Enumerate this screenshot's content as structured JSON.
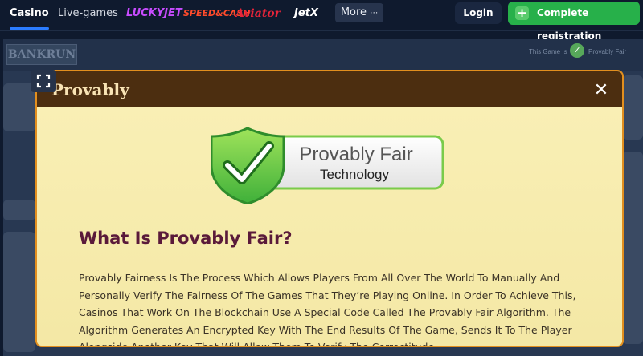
{
  "nav": {
    "tabs": [
      {
        "label": "Casino",
        "active": true
      },
      {
        "label": "Live-games",
        "active": false
      }
    ],
    "game_logos": [
      "LUCKYJET",
      "SPEED&CASH",
      "Aviator",
      "JetX"
    ],
    "more_label": "More",
    "more_icon": "ellipsis-icon",
    "login_label": "Login",
    "register_label": "Complete registration",
    "register_icon": "plus-icon"
  },
  "game": {
    "logo_text": "BANKRUN",
    "status_label": "This Game Is",
    "status_value": "Provably Fair"
  },
  "modal": {
    "title": "Provably",
    "badge": {
      "line1": "Provably Fair",
      "line2": "Technology"
    },
    "heading": "What Is Provably Fair?",
    "paragraph": "Provably Fairness Is The Process Which Allows Players From All Over The World To Manually And Personally Verify The Fairness Of The Games That They’re Playing Online. In Order To Achieve This, Casinos That Work On The Blockchain Use A Special Code Called The Provably Fair Algorithm. The Algorithm Generates An Encrypted Key With The End Results Of The Game, Sends It To The Player Alongside Another Key That Will Allow Them To Verify The Correctitude"
  },
  "colors": {
    "nav_bg": "#0f1a2e",
    "active_tab_underline": "#2b7cff",
    "register_green": "#27b04a",
    "modal_border": "#e28f1e",
    "modal_header": "#4c2e10",
    "modal_body": "#f7eba9",
    "heading": "#5a1a3a"
  }
}
